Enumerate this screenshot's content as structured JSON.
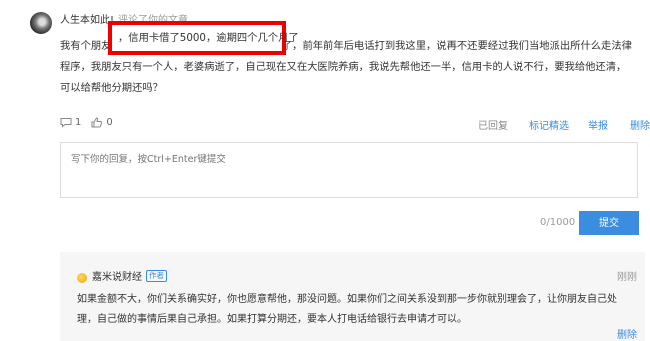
{
  "comment": {
    "username": "人生本如此!",
    "action": "评论了你的文章",
    "body": "我有个朋友，信用卡借了5000，逾期四个几个月了，前年前年后电话打到我这里，说再不还要经过我们当地派出所什么走法律程序，我朋友只有一个人，老婆病逝了，自己现在又在大医院养病，我说先帮他还一半，信用卡的人说不行，要我给他还清，可以给帮他分期还吗？",
    "highlight": "，信用卡借了5000，逾期四个几个月了",
    "comment_count": "1",
    "like_count": "0"
  },
  "ops": {
    "replied": "已回复",
    "mark": "标记精选",
    "report": "举报",
    "delete": "删除"
  },
  "reply_input": {
    "placeholder": "写下你的回复，按Ctrl+Enter键提交",
    "counter": "0/1000",
    "submit": "提交"
  },
  "reply": {
    "author": "嘉米说财经",
    "badge": "作者",
    "time": "刚刚",
    "text": "如果金额不大，你们关系确实好，你也愿意帮他，那没问题。如果你们之间关系没到那一步你就别理会了，让你朋友自己处理，自己做的事情后果自己承担。如果打算分期还，要本人打电话给银行去申请才可以。",
    "delete": "删除"
  },
  "colors": {
    "accent": "#3b8de0",
    "highlight_border": "#e00000",
    "reply_bg": "#f6f6f6"
  }
}
